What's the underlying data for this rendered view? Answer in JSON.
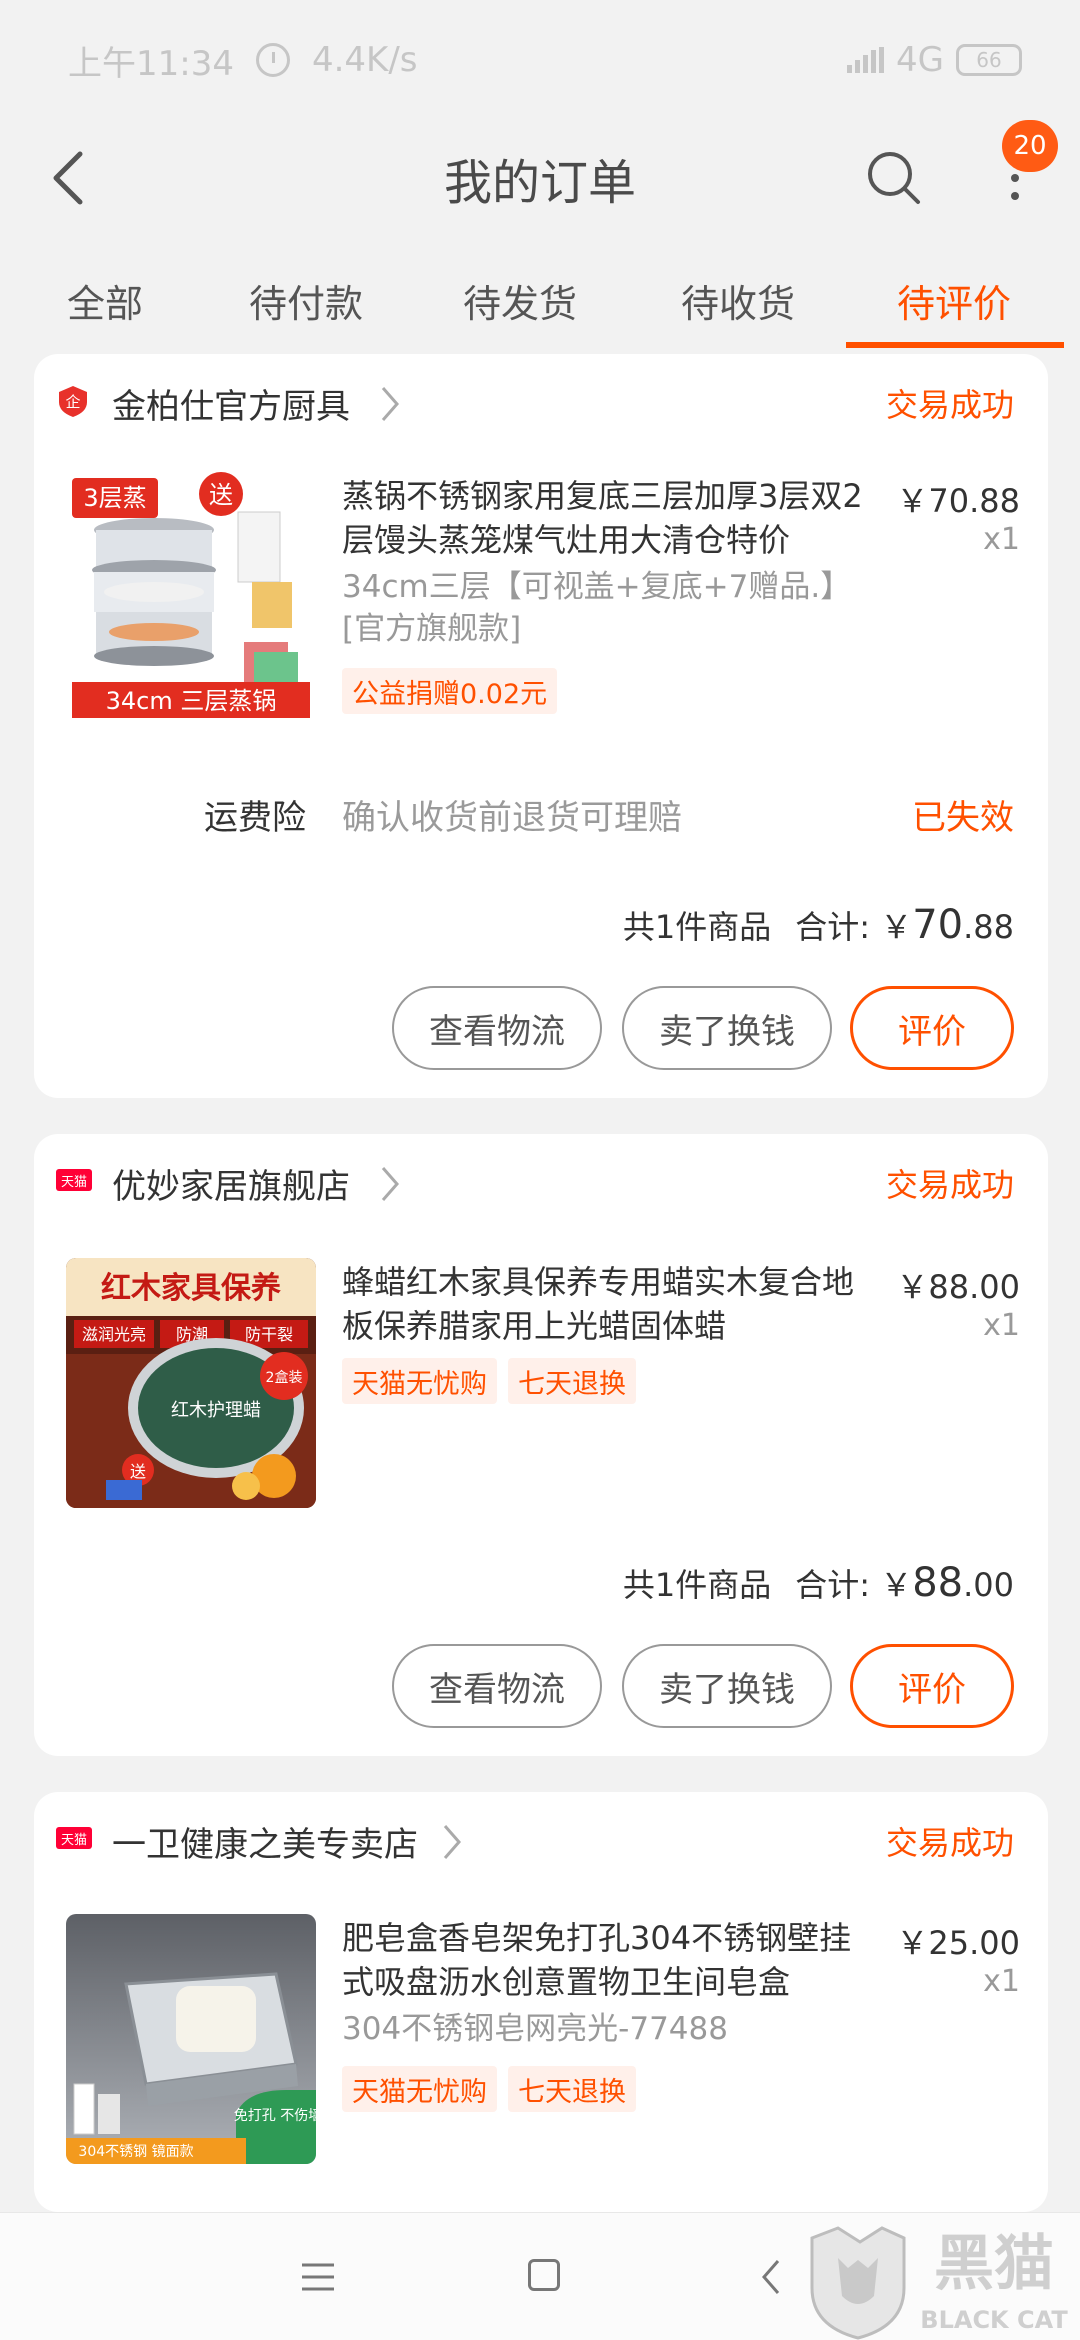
{
  "status_bar": {
    "time": "上午11:34",
    "speed": "4.4K/s",
    "network": "4G",
    "battery": "66"
  },
  "header": {
    "title": "我的订单",
    "badge_count": "20"
  },
  "tabs": [
    {
      "label": "全部",
      "active": false
    },
    {
      "label": "待付款",
      "active": false
    },
    {
      "label": "待发货",
      "active": false
    },
    {
      "label": "待收货",
      "active": false
    },
    {
      "label": "待评价",
      "active": true
    }
  ],
  "orders": [
    {
      "shop_name": "金柏仕官方厨具",
      "shop_icon": "enterprise-badge-icon",
      "status": "交易成功",
      "product_title": "蒸锅不锈钢家用复底三层加厚3层双2层馒头蒸笼煤气灶用大清仓特价",
      "sku": "34cm三层【可视盖+复底+7赠品.】[官方旗舰款]",
      "price": "￥70.88",
      "qty": "x1",
      "tags": [
        "公益捐赠0.02元"
      ],
      "thumb": {
        "badge_left": "3层蒸",
        "badge_right": "送",
        "caption": "34cm  三层蒸锅"
      },
      "insurance": {
        "label": "运费险",
        "desc": "确认收货前退货可理赔",
        "status": "已失效"
      },
      "total": {
        "count_text": "共1件商品",
        "label": "合计:",
        "currency": "￥",
        "int": "70",
        "dec": ".88"
      },
      "buttons": {
        "logistics": "查看物流",
        "resell": "卖了换钱",
        "review": "评价"
      }
    },
    {
      "shop_name": "优妙家居旗舰店",
      "shop_icon": "tmall-icon",
      "status": "交易成功",
      "product_title": "蜂蜡红木家具保养专用蜡实木复合地板保养腊家用上光蜡固体蜡",
      "price": "￥88.00",
      "qty": "x1",
      "tags": [
        "天猫无忧购",
        "七天退换"
      ],
      "thumb": {
        "headline": "红木家具保养",
        "chips": [
          "滋润光亮",
          "防潮",
          "防干裂"
        ],
        "tin_label": "红木护理蜡",
        "badge": "2盒装",
        "gift": "送"
      },
      "total": {
        "count_text": "共1件商品",
        "label": "合计:",
        "currency": "￥",
        "int": "88",
        "dec": ".00"
      },
      "buttons": {
        "logistics": "查看物流",
        "resell": "卖了换钱",
        "review": "评价"
      }
    },
    {
      "shop_name": "一卫健康之美专卖店",
      "shop_icon": "tmall-icon",
      "status": "交易成功",
      "product_title": "肥皂盒香皂架免打孔304不锈钢壁挂式吸盘沥水创意置物卫生间皂盒",
      "sku": "304不锈钢皂网亮光-77488",
      "price": "￥25.00",
      "qty": "x1",
      "tags": [
        "天猫无忧购",
        "七天退换"
      ],
      "thumb": {
        "strip": "304不锈钢 镜面款",
        "badge": "免打孔 不伤墙"
      }
    }
  ],
  "tmall_icon_text": "天猫",
  "watermark": {
    "text": "黑猫",
    "sub": "BLACK CAT"
  }
}
